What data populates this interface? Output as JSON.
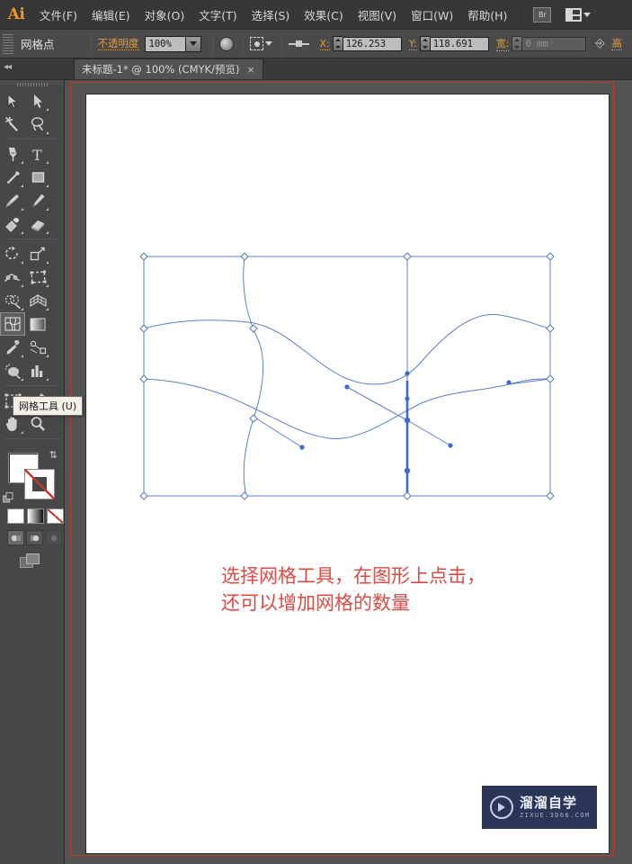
{
  "app": {
    "logo": "Ai",
    "menus": [
      {
        "label": "文件(F)",
        "name": "menu-file"
      },
      {
        "label": "编辑(E)",
        "name": "menu-edit"
      },
      {
        "label": "对象(O)",
        "name": "menu-object"
      },
      {
        "label": "文字(T)",
        "name": "menu-type"
      },
      {
        "label": "选择(S)",
        "name": "menu-select"
      },
      {
        "label": "效果(C)",
        "name": "menu-effect"
      },
      {
        "label": "视图(V)",
        "name": "menu-view"
      },
      {
        "label": "窗口(W)",
        "name": "menu-window"
      },
      {
        "label": "帮助(H)",
        "name": "menu-help"
      }
    ],
    "bridge_button": "Br"
  },
  "control_bar": {
    "selection_label": "网格点",
    "opacity_label": "不透明度",
    "opacity_value": "100%",
    "x_label": "X:",
    "x_value": "126.253",
    "y_label": "Y:",
    "y_value": "118.691",
    "width_label": "宽:",
    "width_value": "0 mm",
    "height_label": "高"
  },
  "tab": {
    "title": "未标题-1* @ 100% (CMYK/预览)",
    "close": "×"
  },
  "toolbox": {
    "tools": [
      {
        "name": "selection-tool",
        "label": "选择工具"
      },
      {
        "name": "direct-selection-tool",
        "label": "直接选择工具"
      },
      {
        "name": "magic-wand-tool",
        "label": "魔棒工具"
      },
      {
        "name": "lasso-tool",
        "label": "套索工具"
      },
      {
        "name": "pen-tool",
        "label": "钢笔工具"
      },
      {
        "name": "type-tool",
        "label": "文字工具"
      },
      {
        "name": "line-segment-tool",
        "label": "直线段工具"
      },
      {
        "name": "rectangle-tool",
        "label": "矩形工具"
      },
      {
        "name": "paintbrush-tool",
        "label": "画笔工具"
      },
      {
        "name": "pencil-tool",
        "label": "铅笔工具"
      },
      {
        "name": "blob-brush-tool",
        "label": "斑点画笔工具"
      },
      {
        "name": "eraser-tool",
        "label": "橡皮擦工具"
      },
      {
        "name": "rotate-tool",
        "label": "旋转工具"
      },
      {
        "name": "scale-tool",
        "label": "比例缩放工具"
      },
      {
        "name": "width-tool",
        "label": "宽度工具"
      },
      {
        "name": "free-transform-tool",
        "label": "自由变换工具"
      },
      {
        "name": "shape-builder-tool",
        "label": "形状生成器工具"
      },
      {
        "name": "perspective-grid-tool",
        "label": "透视网格工具"
      },
      {
        "name": "mesh-tool",
        "label": "网格工具"
      },
      {
        "name": "gradient-tool",
        "label": "渐变工具"
      },
      {
        "name": "eyedropper-tool",
        "label": "吸管工具"
      },
      {
        "name": "blend-tool",
        "label": "混合工具"
      },
      {
        "name": "symbol-sprayer-tool",
        "label": "符号喷枪工具"
      },
      {
        "name": "column-graph-tool",
        "label": "柱形图工具"
      },
      {
        "name": "artboard-tool",
        "label": "画板工具"
      },
      {
        "name": "slice-tool",
        "label": "切片工具"
      },
      {
        "name": "hand-tool",
        "label": "抓手工具"
      },
      {
        "name": "zoom-tool",
        "label": "缩放工具"
      }
    ],
    "active_tool": "mesh-tool",
    "tooltip": "网格工具 (U)",
    "fill_color": "#ffffff",
    "stroke_color": "#ffffff",
    "swatch_modes": [
      "color",
      "gradient",
      "none"
    ],
    "draw_modes": [
      "draw-normal",
      "draw-behind",
      "draw-inside"
    ],
    "screen_mode": "change-screen-mode"
  },
  "document": {
    "annotation_line1": "选择网格工具，在图形上点击，",
    "annotation_line2": "还可以增加网格的数量",
    "annotation_color": "#dd4b45",
    "mesh_color": "#4a6fc4",
    "artboard_border_color": "#c0392b"
  },
  "watermark": {
    "title": "溜溜自学",
    "subtitle": "ZIXUE.3D66.COM",
    "bg": "#2b3558"
  }
}
